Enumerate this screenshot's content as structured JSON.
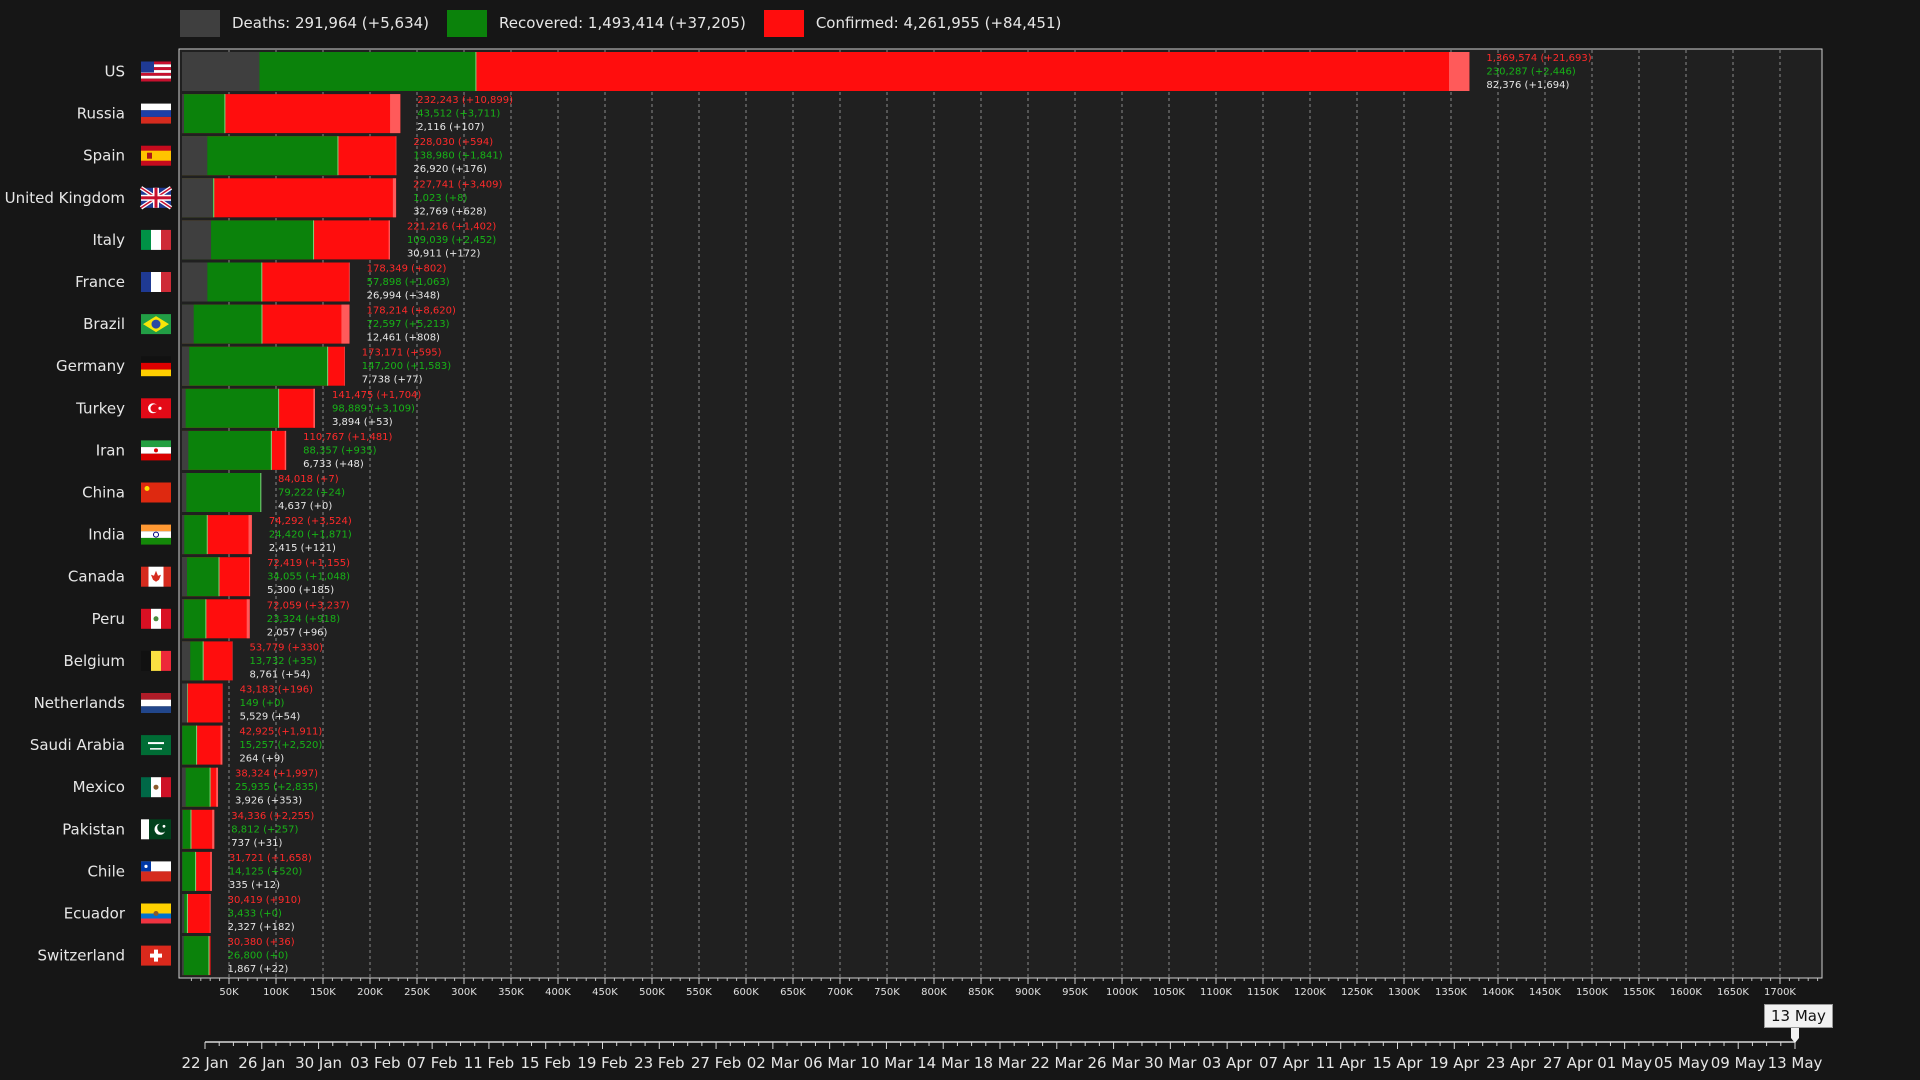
{
  "legend": [
    {
      "key": "deaths",
      "label": "Deaths: 291,964 (+5,634)",
      "color": "#3f3f3f"
    },
    {
      "key": "recovered",
      "label": "Recovered: 1,493,414 (+37,205)",
      "color": "#0b820b"
    },
    {
      "key": "confirmed",
      "label": "Confirmed: 4,261,955 (+84,451)",
      "color": "#ff0d0d"
    }
  ],
  "current_date_label": "13 May",
  "chart_data": {
    "type": "bar",
    "orientation": "horizontal",
    "stacked_overlay": true,
    "xlim": [
      0,
      1750000
    ],
    "x_ticks": [
      50000,
      100000,
      150000,
      200000,
      250000,
      300000,
      350000,
      400000,
      450000,
      500000,
      550000,
      600000,
      650000,
      700000,
      750000,
      800000,
      850000,
      900000,
      950000,
      1000000,
      1050000,
      1100000,
      1150000,
      1200000,
      1250000,
      1300000,
      1350000,
      1400000,
      1450000,
      1500000,
      1550000,
      1600000,
      1650000,
      1700000
    ],
    "x_tick_labels": [
      "50K",
      "100K",
      "150K",
      "200K",
      "250K",
      "300K",
      "350K",
      "400K",
      "450K",
      "500K",
      "550K",
      "600K",
      "650K",
      "700K",
      "750K",
      "800K",
      "850K",
      "900K",
      "950K",
      "1000K",
      "1050K",
      "1100K",
      "1150K",
      "1200K",
      "1250K",
      "1300K",
      "1350K",
      "1400K",
      "1450K",
      "1500K",
      "1550K",
      "1600K",
      "1650K",
      "1700K"
    ],
    "timeline_labels": [
      "22 Jan",
      "26 Jan",
      "30 Jan",
      "03 Feb",
      "07 Feb",
      "11 Feb",
      "15 Feb",
      "19 Feb",
      "23 Feb",
      "27 Feb",
      "02 Mar",
      "06 Mar",
      "10 Mar",
      "14 Mar",
      "18 Mar",
      "22 Mar",
      "26 Mar",
      "30 Mar",
      "03 Apr",
      "07 Apr",
      "11 Apr",
      "15 Apr",
      "19 Apr",
      "23 Apr",
      "27 Apr",
      "01 May",
      "05 May",
      "09 May",
      "13 May"
    ],
    "timeline_position": 1.0,
    "grid": true,
    "colors": {
      "deaths": "#3f3f3f",
      "recovered": "#0b820b",
      "confirmed": "#ff0d0d",
      "confirmed_increase": "#ff5a5a"
    },
    "countries": [
      {
        "name": "US",
        "flag": "us",
        "confirmed": 1369574,
        "confirmed_delta": 21693,
        "recovered": 230287,
        "recovered_delta": 2446,
        "deaths": 82376,
        "deaths_delta": 1694,
        "label_confirmed": "1,369,574 (+21,693)",
        "label_recovered": "230,287 (+2,446)",
        "label_deaths": "82,376 (+1,694)"
      },
      {
        "name": "Russia",
        "flag": "ru",
        "confirmed": 232243,
        "confirmed_delta": 10899,
        "recovered": 43512,
        "recovered_delta": 3711,
        "deaths": 2116,
        "deaths_delta": 107,
        "label_confirmed": "232,243 (+10,899)",
        "label_recovered": "43,512 (+3,711)",
        "label_deaths": "2,116 (+107)"
      },
      {
        "name": "Spain",
        "flag": "es",
        "confirmed": 228030,
        "confirmed_delta": 594,
        "recovered": 138980,
        "recovered_delta": 1841,
        "deaths": 26920,
        "deaths_delta": 176,
        "label_confirmed": "228,030 (+594)",
        "label_recovered": "138,980 (+1,841)",
        "label_deaths": "26,920 (+176)"
      },
      {
        "name": "United Kingdom",
        "flag": "gb",
        "confirmed": 227741,
        "confirmed_delta": 3409,
        "recovered": 1023,
        "recovered_delta": 8,
        "deaths": 32769,
        "deaths_delta": 628,
        "label_confirmed": "227,741 (+3,409)",
        "label_recovered": "1,023 (+8)",
        "label_deaths": "32,769 (+628)"
      },
      {
        "name": "Italy",
        "flag": "it",
        "confirmed": 221216,
        "confirmed_delta": 1402,
        "recovered": 109039,
        "recovered_delta": 2452,
        "deaths": 30911,
        "deaths_delta": 172,
        "label_confirmed": "221,216 (+1,402)",
        "label_recovered": "109,039 (+2,452)",
        "label_deaths": "30,911 (+172)"
      },
      {
        "name": "France",
        "flag": "fr",
        "confirmed": 178349,
        "confirmed_delta": 802,
        "recovered": 57898,
        "recovered_delta": 1063,
        "deaths": 26994,
        "deaths_delta": 348,
        "label_confirmed": "178,349 (+802)",
        "label_recovered": "57,898 (+1,063)",
        "label_deaths": "26,994 (+348)"
      },
      {
        "name": "Brazil",
        "flag": "br",
        "confirmed": 178214,
        "confirmed_delta": 8620,
        "recovered": 72597,
        "recovered_delta": 5213,
        "deaths": 12461,
        "deaths_delta": 808,
        "label_confirmed": "178,214 (+8,620)",
        "label_recovered": "72,597 (+5,213)",
        "label_deaths": "12,461 (+808)"
      },
      {
        "name": "Germany",
        "flag": "de",
        "confirmed": 173171,
        "confirmed_delta": 595,
        "recovered": 147200,
        "recovered_delta": 1583,
        "deaths": 7738,
        "deaths_delta": 77,
        "label_confirmed": "173,171 (+595)",
        "label_recovered": "147,200 (+1,583)",
        "label_deaths": "7,738 (+77)"
      },
      {
        "name": "Turkey",
        "flag": "tr",
        "confirmed": 141475,
        "confirmed_delta": 1704,
        "recovered": 98889,
        "recovered_delta": 3109,
        "deaths": 3894,
        "deaths_delta": 53,
        "label_confirmed": "141,475 (+1,704)",
        "label_recovered": "98,889 (+3,109)",
        "label_deaths": "3,894 (+53)"
      },
      {
        "name": "Iran",
        "flag": "ir",
        "confirmed": 110767,
        "confirmed_delta": 1481,
        "recovered": 88357,
        "recovered_delta": 935,
        "deaths": 6733,
        "deaths_delta": 48,
        "label_confirmed": "110,767 (+1,481)",
        "label_recovered": "88,357 (+935)",
        "label_deaths": "6,733 (+48)"
      },
      {
        "name": "China",
        "flag": "cn",
        "confirmed": 84018,
        "confirmed_delta": 7,
        "recovered": 79222,
        "recovered_delta": 24,
        "deaths": 4637,
        "deaths_delta": 0,
        "label_confirmed": "84,018 (+7)",
        "label_recovered": "79,222 (+24)",
        "label_deaths": "4,637 (+0)"
      },
      {
        "name": "India",
        "flag": "in",
        "confirmed": 74292,
        "confirmed_delta": 3524,
        "recovered": 24420,
        "recovered_delta": 1871,
        "deaths": 2415,
        "deaths_delta": 121,
        "label_confirmed": "74,292 (+3,524)",
        "label_recovered": "24,420 (+1,871)",
        "label_deaths": "2,415 (+121)"
      },
      {
        "name": "Canada",
        "flag": "ca",
        "confirmed": 72419,
        "confirmed_delta": 1155,
        "recovered": 34055,
        "recovered_delta": 1048,
        "deaths": 5300,
        "deaths_delta": 185,
        "label_confirmed": "72,419 (+1,155)",
        "label_recovered": "34,055 (+1,048)",
        "label_deaths": "5,300 (+185)"
      },
      {
        "name": "Peru",
        "flag": "pe",
        "confirmed": 72059,
        "confirmed_delta": 3237,
        "recovered": 23324,
        "recovered_delta": 918,
        "deaths": 2057,
        "deaths_delta": 96,
        "label_confirmed": "72,059 (+3,237)",
        "label_recovered": "23,324 (+918)",
        "label_deaths": "2,057 (+96)"
      },
      {
        "name": "Belgium",
        "flag": "be",
        "confirmed": 53779,
        "confirmed_delta": 330,
        "recovered": 13732,
        "recovered_delta": 35,
        "deaths": 8761,
        "deaths_delta": 54,
        "label_confirmed": "53,779 (+330)",
        "label_recovered": "13,732 (+35)",
        "label_deaths": "8,761 (+54)"
      },
      {
        "name": "Netherlands",
        "flag": "nl",
        "confirmed": 43183,
        "confirmed_delta": 196,
        "recovered": 149,
        "recovered_delta": 0,
        "deaths": 5529,
        "deaths_delta": 54,
        "label_confirmed": "43,183 (+196)",
        "label_recovered": "149 (+0)",
        "label_deaths": "5,529 (+54)"
      },
      {
        "name": "Saudi Arabia",
        "flag": "sa",
        "confirmed": 42925,
        "confirmed_delta": 1911,
        "recovered": 15257,
        "recovered_delta": 2520,
        "deaths": 264,
        "deaths_delta": 9,
        "label_confirmed": "42,925 (+1,911)",
        "label_recovered": "15,257 (+2,520)",
        "label_deaths": "264 (+9)"
      },
      {
        "name": "Mexico",
        "flag": "mx",
        "confirmed": 38324,
        "confirmed_delta": 1997,
        "recovered": 25935,
        "recovered_delta": 2835,
        "deaths": 3926,
        "deaths_delta": 353,
        "label_confirmed": "38,324 (+1,997)",
        "label_recovered": "25,935 (+2,835)",
        "label_deaths": "3,926 (+353)"
      },
      {
        "name": "Pakistan",
        "flag": "pk",
        "confirmed": 34336,
        "confirmed_delta": 2255,
        "recovered": 8812,
        "recovered_delta": 257,
        "deaths": 737,
        "deaths_delta": 31,
        "label_confirmed": "34,336 (+2,255)",
        "label_recovered": "8,812 (+257)",
        "label_deaths": "737 (+31)"
      },
      {
        "name": "Chile",
        "flag": "cl",
        "confirmed": 31721,
        "confirmed_delta": 1658,
        "recovered": 14125,
        "recovered_delta": 520,
        "deaths": 335,
        "deaths_delta": 12,
        "label_confirmed": "31,721 (+1,658)",
        "label_recovered": "14,125 (+520)",
        "label_deaths": "335 (+12)"
      },
      {
        "name": "Ecuador",
        "flag": "ec",
        "confirmed": 30419,
        "confirmed_delta": 910,
        "recovered": 3433,
        "recovered_delta": 0,
        "deaths": 2327,
        "deaths_delta": 182,
        "label_confirmed": "30,419 (+910)",
        "label_recovered": "3,433 (+0)",
        "label_deaths": "2,327 (+182)"
      },
      {
        "name": "Switzerland",
        "flag": "ch",
        "confirmed": 30380,
        "confirmed_delta": 36,
        "recovered": 26800,
        "recovered_delta": 0,
        "deaths": 1867,
        "deaths_delta": 22,
        "label_confirmed": "30,380 (+36)",
        "label_recovered": "26,800 (+0)",
        "label_deaths": "1,867 (+22)"
      }
    ]
  }
}
